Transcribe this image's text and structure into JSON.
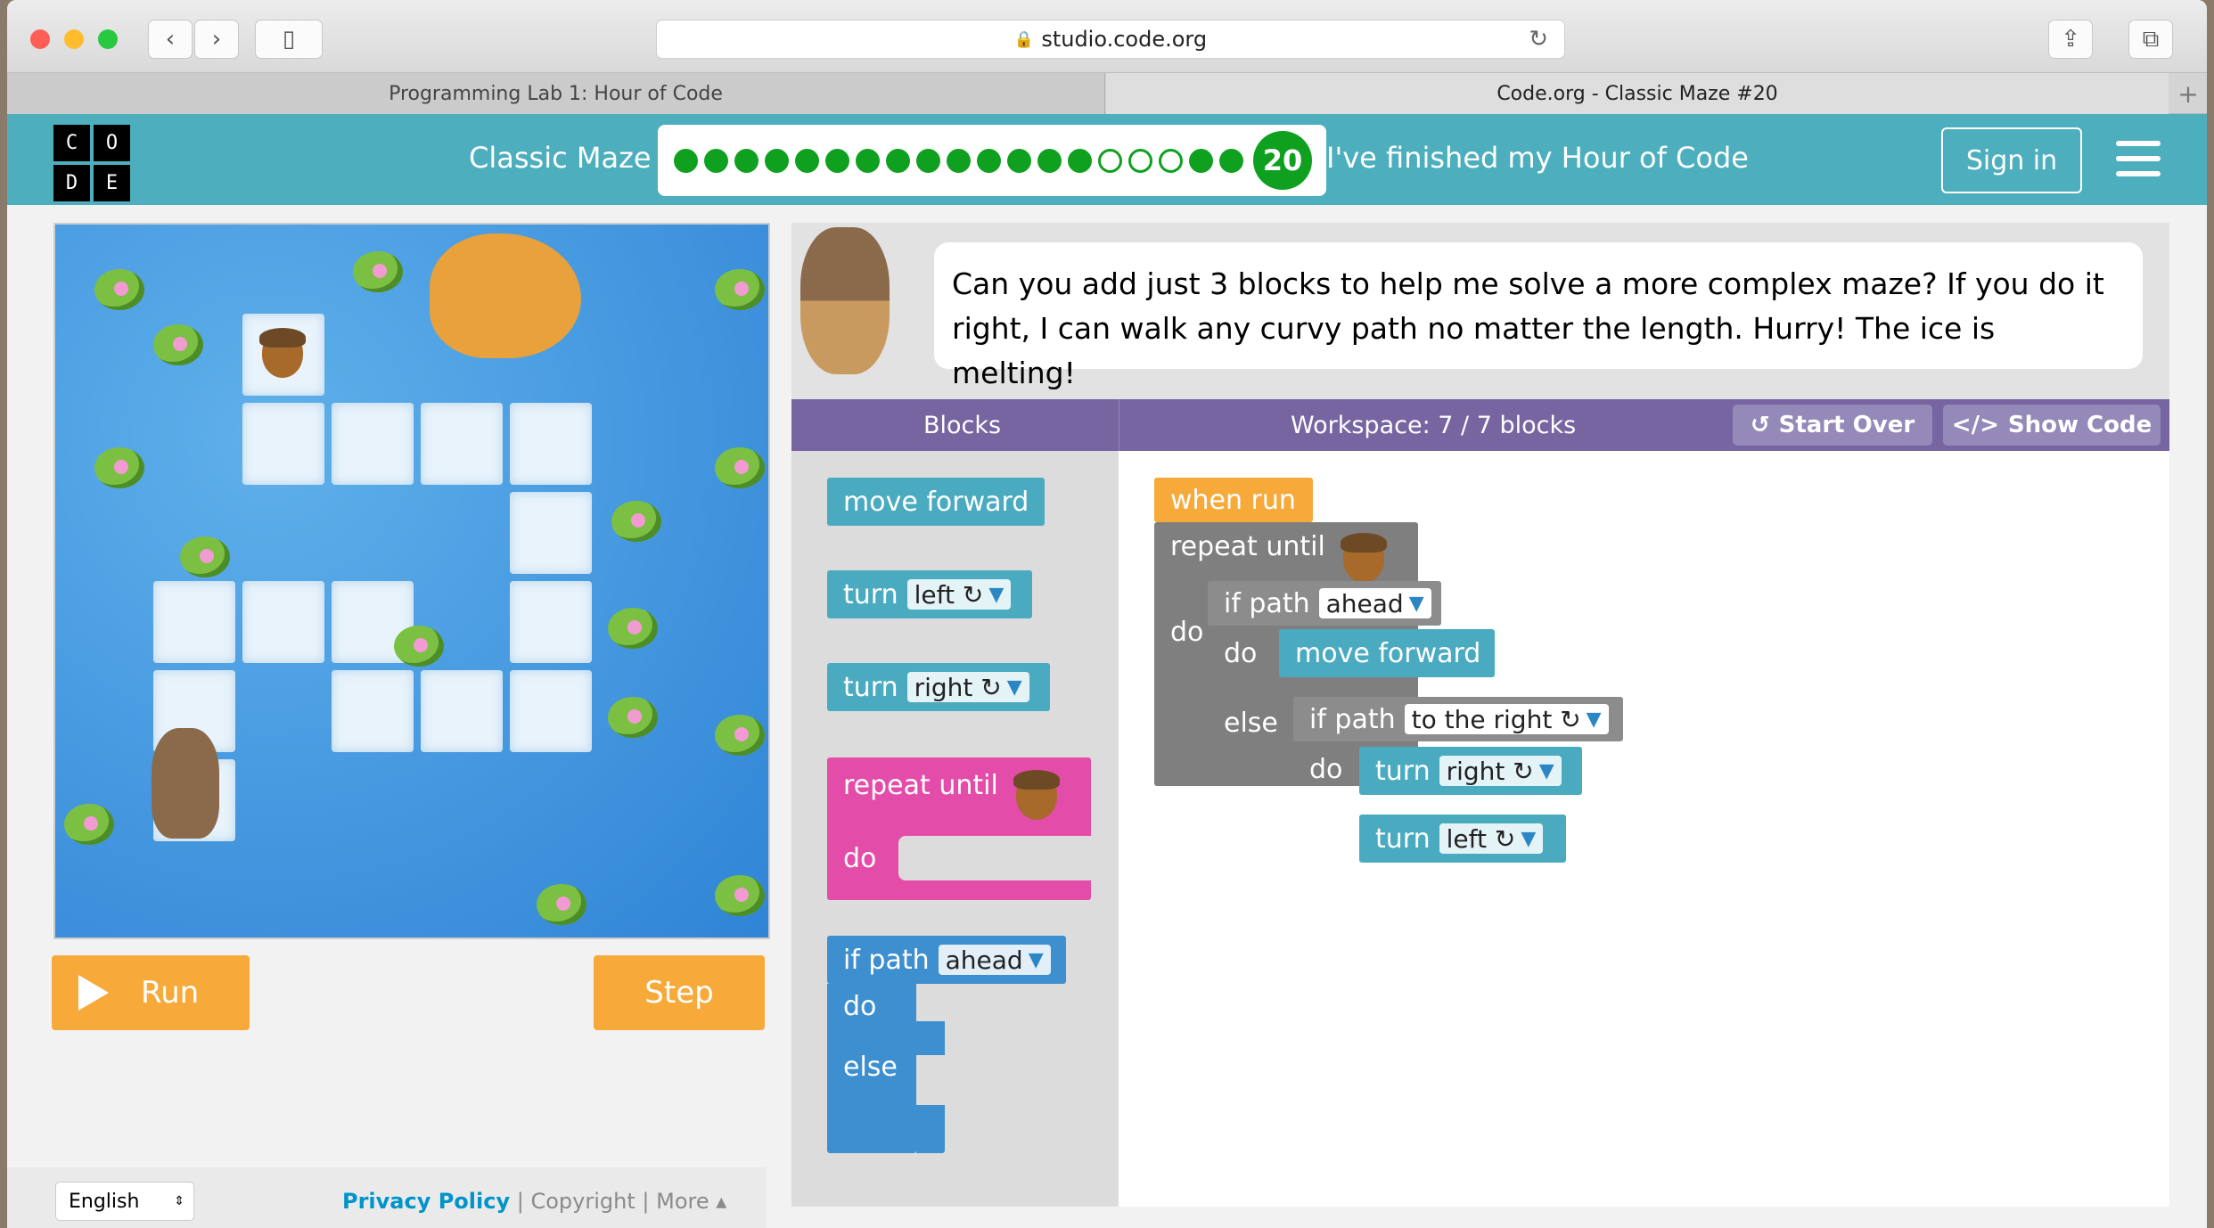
{
  "browser": {
    "url": "studio.code.org",
    "tabs": [
      {
        "label": "Programming Lab 1: Hour of Code"
      },
      {
        "label": "Code.org - Classic Maze #20"
      }
    ],
    "new_tab_label": "+"
  },
  "header": {
    "logo_letters": [
      "C",
      "O",
      "D",
      "E"
    ],
    "level_title": "Classic Maze",
    "current_level": "20",
    "progress": {
      "completed": 14,
      "attempted": 3,
      "total": 19
    },
    "finished_link": "I've finished my Hour of Code",
    "signin_label": "Sign in"
  },
  "controls": {
    "run_label": "Run",
    "step_label": "Step"
  },
  "footer": {
    "language": "English",
    "privacy": "Privacy Policy",
    "copyright": "Copyright",
    "more": "More ▴"
  },
  "instructions": {
    "text": "Can you add just 3 blocks to help me solve a more complex maze? If you do it right, I can walk any curvy path no matter the length. Hurry! The ice is melting!"
  },
  "editor": {
    "blocks_header": "Blocks",
    "workspace_header": "Workspace: 7 / 7 blocks",
    "start_over": "Start Over",
    "show_code": "Show Code"
  },
  "toolbox": {
    "move_forward": "move forward",
    "turn": "turn",
    "left": "left ↻",
    "right": "right ↻",
    "repeat_until": "repeat until",
    "do": "do",
    "if_path": "if path",
    "ahead": "ahead",
    "else": "else"
  },
  "program": {
    "when_run": "when run",
    "repeat_until": "repeat until",
    "do": "do",
    "if_path": "if path",
    "ahead": "ahead",
    "move_forward": "move forward",
    "else": "else",
    "to_the_right": "to the right ↻",
    "turn": "turn",
    "right": "right ↻",
    "left": "left ↻"
  },
  "colors": {
    "header": "#4dafbd",
    "action_block": "#4aabc0",
    "loop_block": "#e34ca8",
    "conditional_block": "#3d8fd0",
    "event_block": "#f7a93a",
    "progress_green": "#0fa020"
  }
}
